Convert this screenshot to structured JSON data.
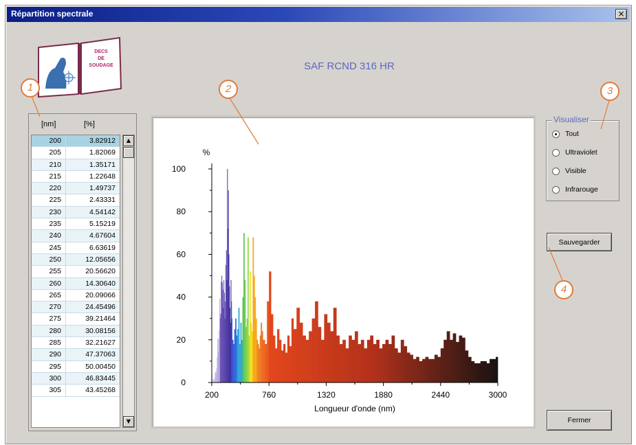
{
  "window": {
    "title": "Répartition spectrale",
    "close_glyph": "×"
  },
  "app_title": "SAF RCND 316 HR",
  "book": {
    "page_text_1": "DECS",
    "page_text_2": "DE",
    "page_text_3": "SOUDAGE"
  },
  "callouts": [
    "1",
    "2",
    "3",
    "4"
  ],
  "table": {
    "headers": [
      "[nm]",
      "[%]"
    ],
    "rows": [
      [
        "200",
        "3.82912"
      ],
      [
        "205",
        "1.82069"
      ],
      [
        "210",
        "1.35171"
      ],
      [
        "215",
        "1.22648"
      ],
      [
        "220",
        "1.49737"
      ],
      [
        "225",
        "2.43331"
      ],
      [
        "230",
        "4.54142"
      ],
      [
        "235",
        "5.15219"
      ],
      [
        "240",
        "4.67604"
      ],
      [
        "245",
        "6.63619"
      ],
      [
        "250",
        "12.05656"
      ],
      [
        "255",
        "20.56620"
      ],
      [
        "260",
        "14.30640"
      ],
      [
        "265",
        "20.09066"
      ],
      [
        "270",
        "24.45496"
      ],
      [
        "275",
        "39.21464"
      ],
      [
        "280",
        "30.08156"
      ],
      [
        "285",
        "32.21627"
      ],
      [
        "290",
        "47.37063"
      ],
      [
        "295",
        "50.00450"
      ],
      [
        "300",
        "46.83445"
      ],
      [
        "305",
        "43.45268"
      ]
    ],
    "scroll_up": "▲",
    "scroll_down": "▼"
  },
  "visualiser": {
    "label": "Visualiser",
    "options": [
      {
        "label": "Tout",
        "checked": true
      },
      {
        "label": "Ultraviolet",
        "checked": false
      },
      {
        "label": "Visible",
        "checked": false
      },
      {
        "label": "Infrarouge",
        "checked": false
      }
    ]
  },
  "buttons": {
    "save": "Sauvegarder",
    "close": "Fermer"
  },
  "chart_data": {
    "type": "bar",
    "ylabel": "%",
    "xlabel": "Longueur d'onde (nm)",
    "xlim": [
      200,
      3000
    ],
    "ylim": [
      0,
      100
    ],
    "x_ticks": [
      "200",
      "760",
      "1320",
      "1880",
      "2440",
      "3000"
    ],
    "y_ticks": [
      "0",
      "20",
      "40",
      "60",
      "80",
      "100"
    ],
    "grid": false,
    "x": [
      200,
      205,
      210,
      215,
      220,
      225,
      230,
      235,
      240,
      245,
      250,
      255,
      260,
      265,
      270,
      275,
      280,
      285,
      290,
      295,
      300,
      305,
      310,
      315,
      320,
      325,
      330,
      335,
      340,
      345,
      350,
      355,
      360,
      365,
      370,
      375,
      380,
      385,
      390,
      395,
      400,
      410,
      420,
      430,
      440,
      450,
      460,
      470,
      480,
      490,
      500,
      510,
      520,
      530,
      540,
      550,
      560,
      570,
      580,
      590,
      600,
      610,
      620,
      630,
      640,
      650,
      660,
      670,
      680,
      690,
      700,
      720,
      740,
      760,
      780,
      800,
      820,
      840,
      860,
      880,
      900,
      920,
      940,
      960,
      980,
      1000,
      1030,
      1060,
      1090,
      1120,
      1150,
      1180,
      1210,
      1240,
      1270,
      1300,
      1330,
      1360,
      1390,
      1420,
      1450,
      1480,
      1510,
      1540,
      1570,
      1600,
      1630,
      1660,
      1690,
      1720,
      1750,
      1780,
      1810,
      1840,
      1870,
      1900,
      1930,
      1960,
      1990,
      2020,
      2050,
      2080,
      2110,
      2140,
      2170,
      2200,
      2230,
      2260,
      2290,
      2320,
      2350,
      2380,
      2410,
      2440,
      2470,
      2500,
      2530,
      2560,
      2590,
      2620,
      2650,
      2680,
      2710,
      2740,
      2770,
      2800,
      2830,
      2860,
      2890,
      2920,
      2950,
      2980
    ],
    "values": [
      3.83,
      1.82,
      1.35,
      1.23,
      1.5,
      2.43,
      4.54,
      5.15,
      4.68,
      6.64,
      12.06,
      20.57,
      14.31,
      20.09,
      24.45,
      39.21,
      30.08,
      32.22,
      47.37,
      50.0,
      46.83,
      43.45,
      35,
      48,
      42,
      30,
      38,
      55,
      62,
      48,
      100,
      72,
      90,
      60,
      45,
      35,
      28,
      48,
      38,
      30,
      20,
      18,
      25,
      30,
      22,
      25,
      35,
      18,
      28,
      20,
      40,
      70,
      48,
      26,
      30,
      68,
      22,
      52,
      28,
      24,
      68,
      50,
      40,
      30,
      20,
      18,
      16,
      22,
      28,
      24,
      20,
      18,
      38,
      52,
      32,
      22,
      16,
      25,
      20,
      15,
      18,
      14,
      22,
      17,
      30,
      25,
      35,
      28,
      22,
      20,
      24,
      30,
      38,
      26,
      20,
      32,
      28,
      24,
      35,
      22,
      18,
      20,
      16,
      22,
      20,
      24,
      18,
      20,
      16,
      20,
      22,
      18,
      20,
      16,
      18,
      20,
      18,
      22,
      16,
      14,
      20,
      17,
      14,
      13,
      11,
      12,
      10,
      11,
      12,
      11,
      11,
      13,
      12,
      16,
      20,
      24,
      20,
      23,
      19,
      22,
      21,
      15,
      12,
      10,
      9,
      9,
      10,
      10,
      9,
      11,
      11,
      12
    ]
  }
}
